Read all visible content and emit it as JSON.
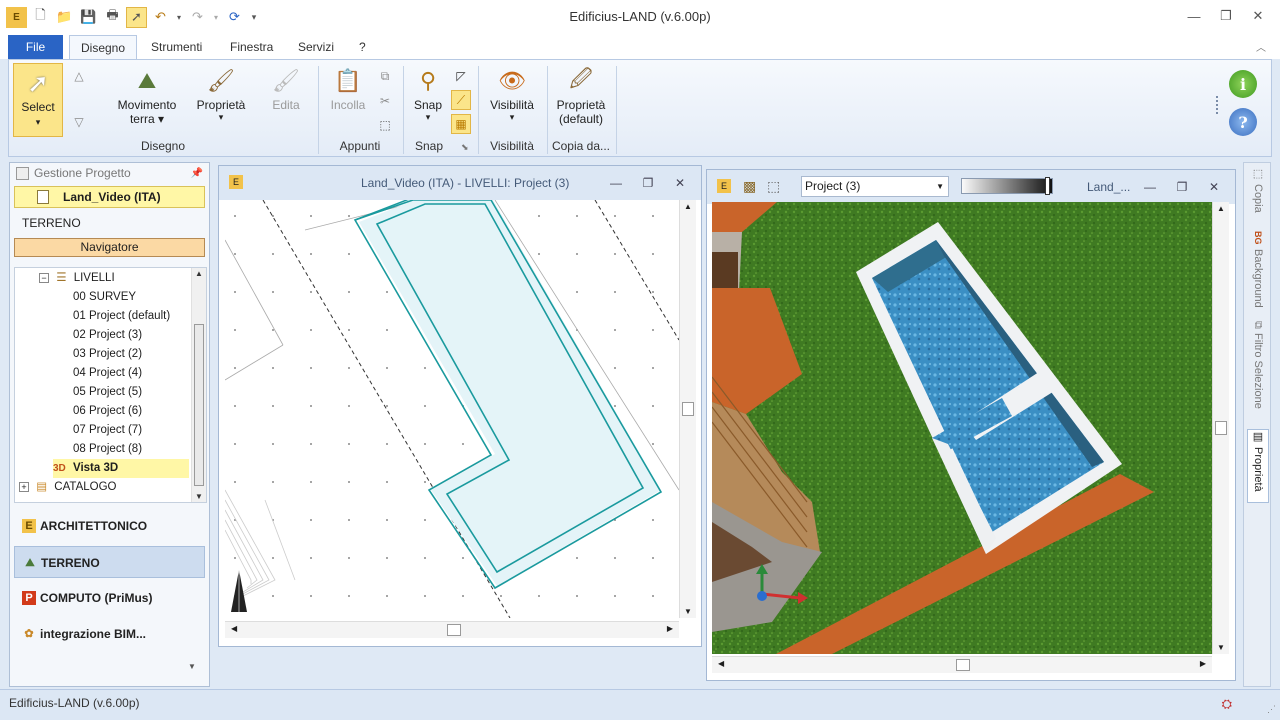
{
  "app": {
    "title": "Edificius-LAND (v.6.00p)"
  },
  "ribbon_tabs": {
    "file": "File",
    "disegno": "Disegno",
    "strumenti": "Strumenti",
    "finestra": "Finestra",
    "servizi": "Servizi",
    "help": "?"
  },
  "ribbon": {
    "select": "Select",
    "movimento_l1": "Movimento",
    "movimento_l2": "terra",
    "proprieta": "Proprietà",
    "edita": "Edita",
    "incolla": "Incolla",
    "snap": "Snap",
    "visibilita": "Visibilità",
    "proprieta_def_l1": "Proprietà",
    "proprieta_def_l2": "(default)",
    "groups": {
      "disegno": "Disegno",
      "appunti": "Appunti",
      "snap": "Snap",
      "visibilita": "Visibilità",
      "copia": "Copia da..."
    }
  },
  "left_panel": {
    "header": "Gestione Progetto",
    "project": "Land_Video (ITA)",
    "section": "TERRENO",
    "navigator": "Navigatore",
    "tree": {
      "livelli": "LIVELLI",
      "items": [
        "00 SURVEY",
        "01 Project (default)",
        "02 Project (3)",
        "03 Project (2)",
        "04 Project (4)",
        "05 Project (5)",
        "06 Project (6)",
        "07 Project (7)",
        "08 Project (8)"
      ],
      "vista": "Vista 3D",
      "catalogo": "CATALOGO"
    },
    "modules": [
      "ARCHITETTONICO",
      "TERRENO",
      "COMPUTO (PriMus)",
      "integrazione BIM..."
    ]
  },
  "plan_view": {
    "title": "Land_Video (ITA) -  LIVELLI: Project (3)"
  },
  "view3d": {
    "dropdown_value": "Project (3)",
    "title": "Land_..."
  },
  "right_tabs": [
    "Copia",
    "Background",
    "Filtro Selezione",
    "Proprietà"
  ],
  "status": {
    "text": "Edificius-LAND (v.6.00p)"
  },
  "colors": {
    "accent": "#2a64c5",
    "selected_yellow": "#fbe58a",
    "pool_outline": "#1a9a9e",
    "grass": "#3f7a22",
    "wood": "#c9642a"
  }
}
